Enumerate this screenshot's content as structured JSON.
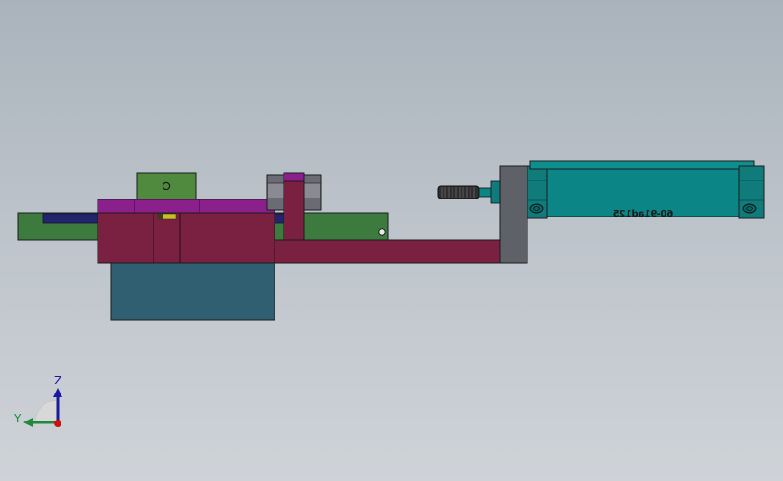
{
  "view": {
    "background_top": "#aab3bc",
    "background_bottom": "#cfd3d8"
  },
  "cylinder": {
    "label": "60-91ad125",
    "body_color": "#0b8585",
    "end_cap_color": "#0f7b7b",
    "rod_color": "#2f2f2f"
  },
  "triad": {
    "z_label": "Z",
    "y_label": "Y",
    "z_color": "#1a1aa0",
    "y_color": "#1e8a3a",
    "x_color": "#cc1111"
  },
  "colors": {
    "maroon": "#7a2040",
    "purple": "#8b1f8b",
    "green": "#3d7a3d",
    "olive_green": "#4f8a3f",
    "slate": "#2f5f70",
    "gray": "#5f6169",
    "navy": "#23236e",
    "yellow": "#c8c020"
  }
}
